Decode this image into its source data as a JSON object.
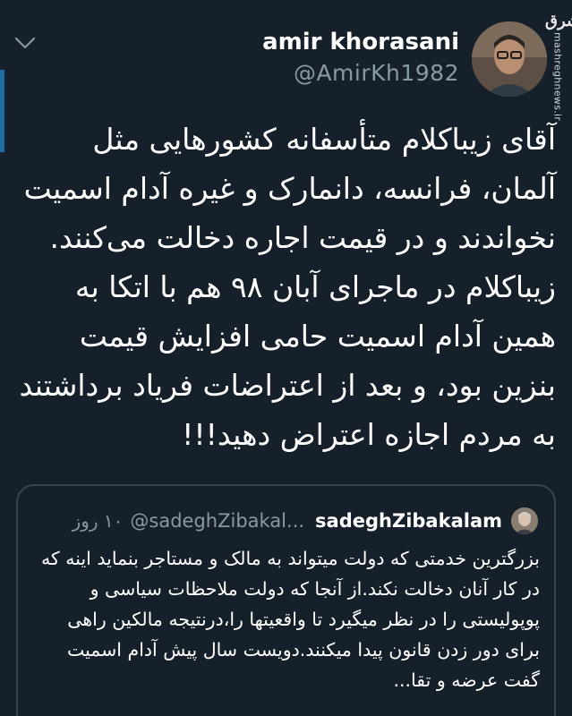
{
  "colors": {
    "background": "#15202b",
    "primary_text": "#ffffff",
    "secondary_text": "#8899a6",
    "border": "#38444d",
    "accent": "#1d6fa5"
  },
  "icons": {
    "more": "chevron-down-icon",
    "avatar": "user-avatar",
    "quoted_avatar": "quoted-user-avatar"
  },
  "watermark": {
    "logo": "مشرق",
    "url": "mashreghnews.ir"
  },
  "tweet": {
    "display_name": "amir khorasani",
    "handle": "@AmirKh1982",
    "text": "آقای زیباکلام متأسفانه کشورهایی مثل آلمان، فرانسه، دانمارک و غیره آدام اسمیت نخواندند و در قیمت اجاره دخالت می‌کنند. زیباکلام در ماجرای آبان ۹۸ هم با اتکا به همین آدام اسمیت حامی افزایش قیمت بنزین بود، و بعد از اعتراضات فریاد برداشتند به مردم اجازه اعتراض دهید!!!"
  },
  "quoted_tweet": {
    "display_name": "sadeghZibakalam",
    "handle": "@sadeghZibakal...",
    "time": "۱۰ روز",
    "text": "بزرگترین خدمتی که دولت میتواند به مالک و مستاجر بنماید اینه که در کار آنان دخالت نکند.از آنجا که دولت ملاحظات سیاسی و پوپولیستی را در نظر میگیرد تا واقعیتها را،درنتیجه مالکین راهی برای دور زدن قانون پیدا میکنند.دویست سال پیش آدام اسمیت گفت عرضه و تقا..."
  }
}
